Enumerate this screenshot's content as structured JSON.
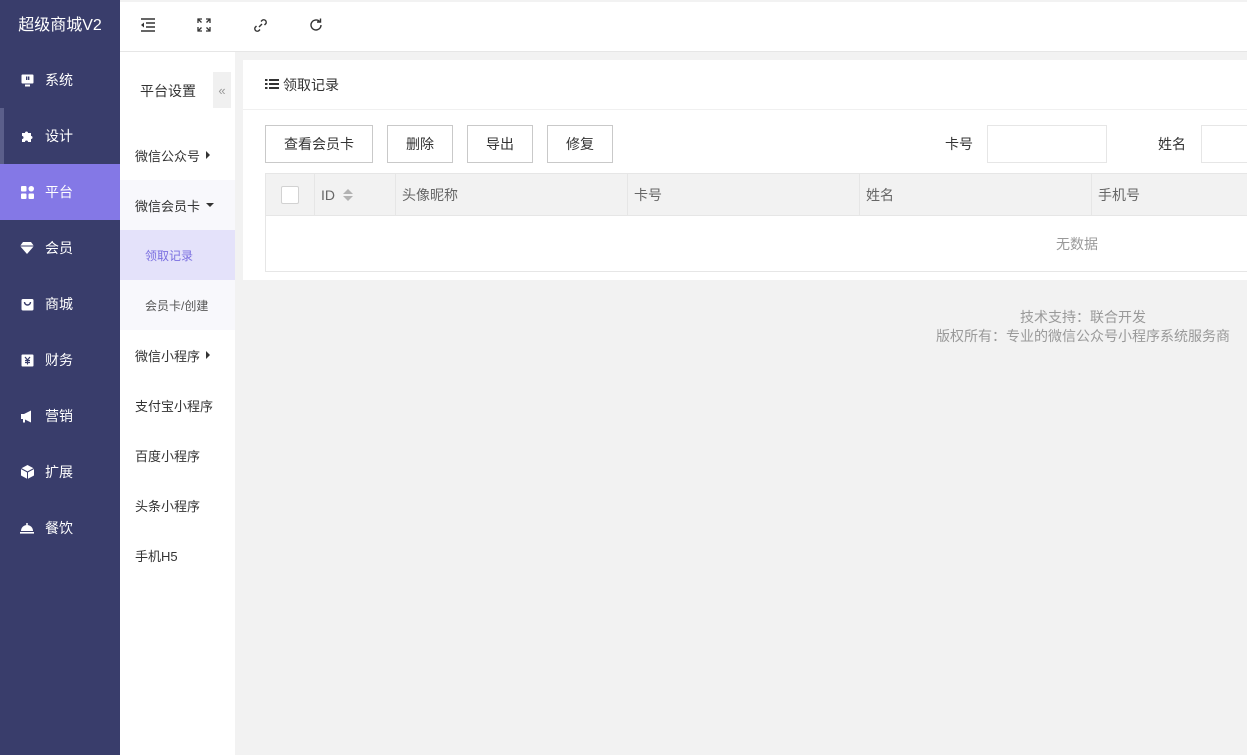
{
  "brand": "超级商城V2",
  "sidebar": {
    "items": [
      {
        "label": "系统",
        "icon": "monitor-icon"
      },
      {
        "label": "设计",
        "icon": "puzzle-icon"
      },
      {
        "label": "平台",
        "icon": "grid-icon"
      },
      {
        "label": "会员",
        "icon": "diamond-icon"
      },
      {
        "label": "商城",
        "icon": "shopping-bag-icon"
      },
      {
        "label": "财务",
        "icon": "finance-icon"
      },
      {
        "label": "营销",
        "icon": "megaphone-icon"
      },
      {
        "label": "扩展",
        "icon": "cube-icon"
      },
      {
        "label": "餐饮",
        "icon": "dish-icon"
      }
    ]
  },
  "submenu": {
    "title": "平台设置",
    "collapse": "«",
    "items": [
      {
        "label": "微信公众号"
      },
      {
        "label": "微信会员卡"
      },
      {
        "label": "领取记录"
      },
      {
        "label": "会员卡/创建"
      },
      {
        "label": "微信小程序"
      },
      {
        "label": "支付宝小程序"
      },
      {
        "label": "百度小程序"
      },
      {
        "label": "头条小程序"
      },
      {
        "label": "手机H5"
      }
    ]
  },
  "card": {
    "title": "领取记录",
    "buttons": {
      "view": "查看会员卡",
      "delete": "删除",
      "export": "导出",
      "repair": "修复"
    },
    "search": {
      "card_label": "卡号",
      "name_label": "姓名"
    },
    "table": {
      "columns": [
        "ID",
        "头像昵称",
        "卡号",
        "姓名",
        "手机号"
      ],
      "empty": "无数据"
    }
  },
  "footer": {
    "line1": "技术支持：联合开发",
    "line2": "版权所有：专业的微信公众号小程序系统服务商"
  },
  "colors": {
    "sidebar_bg": "#393d6b",
    "accent": "#8478e6"
  }
}
